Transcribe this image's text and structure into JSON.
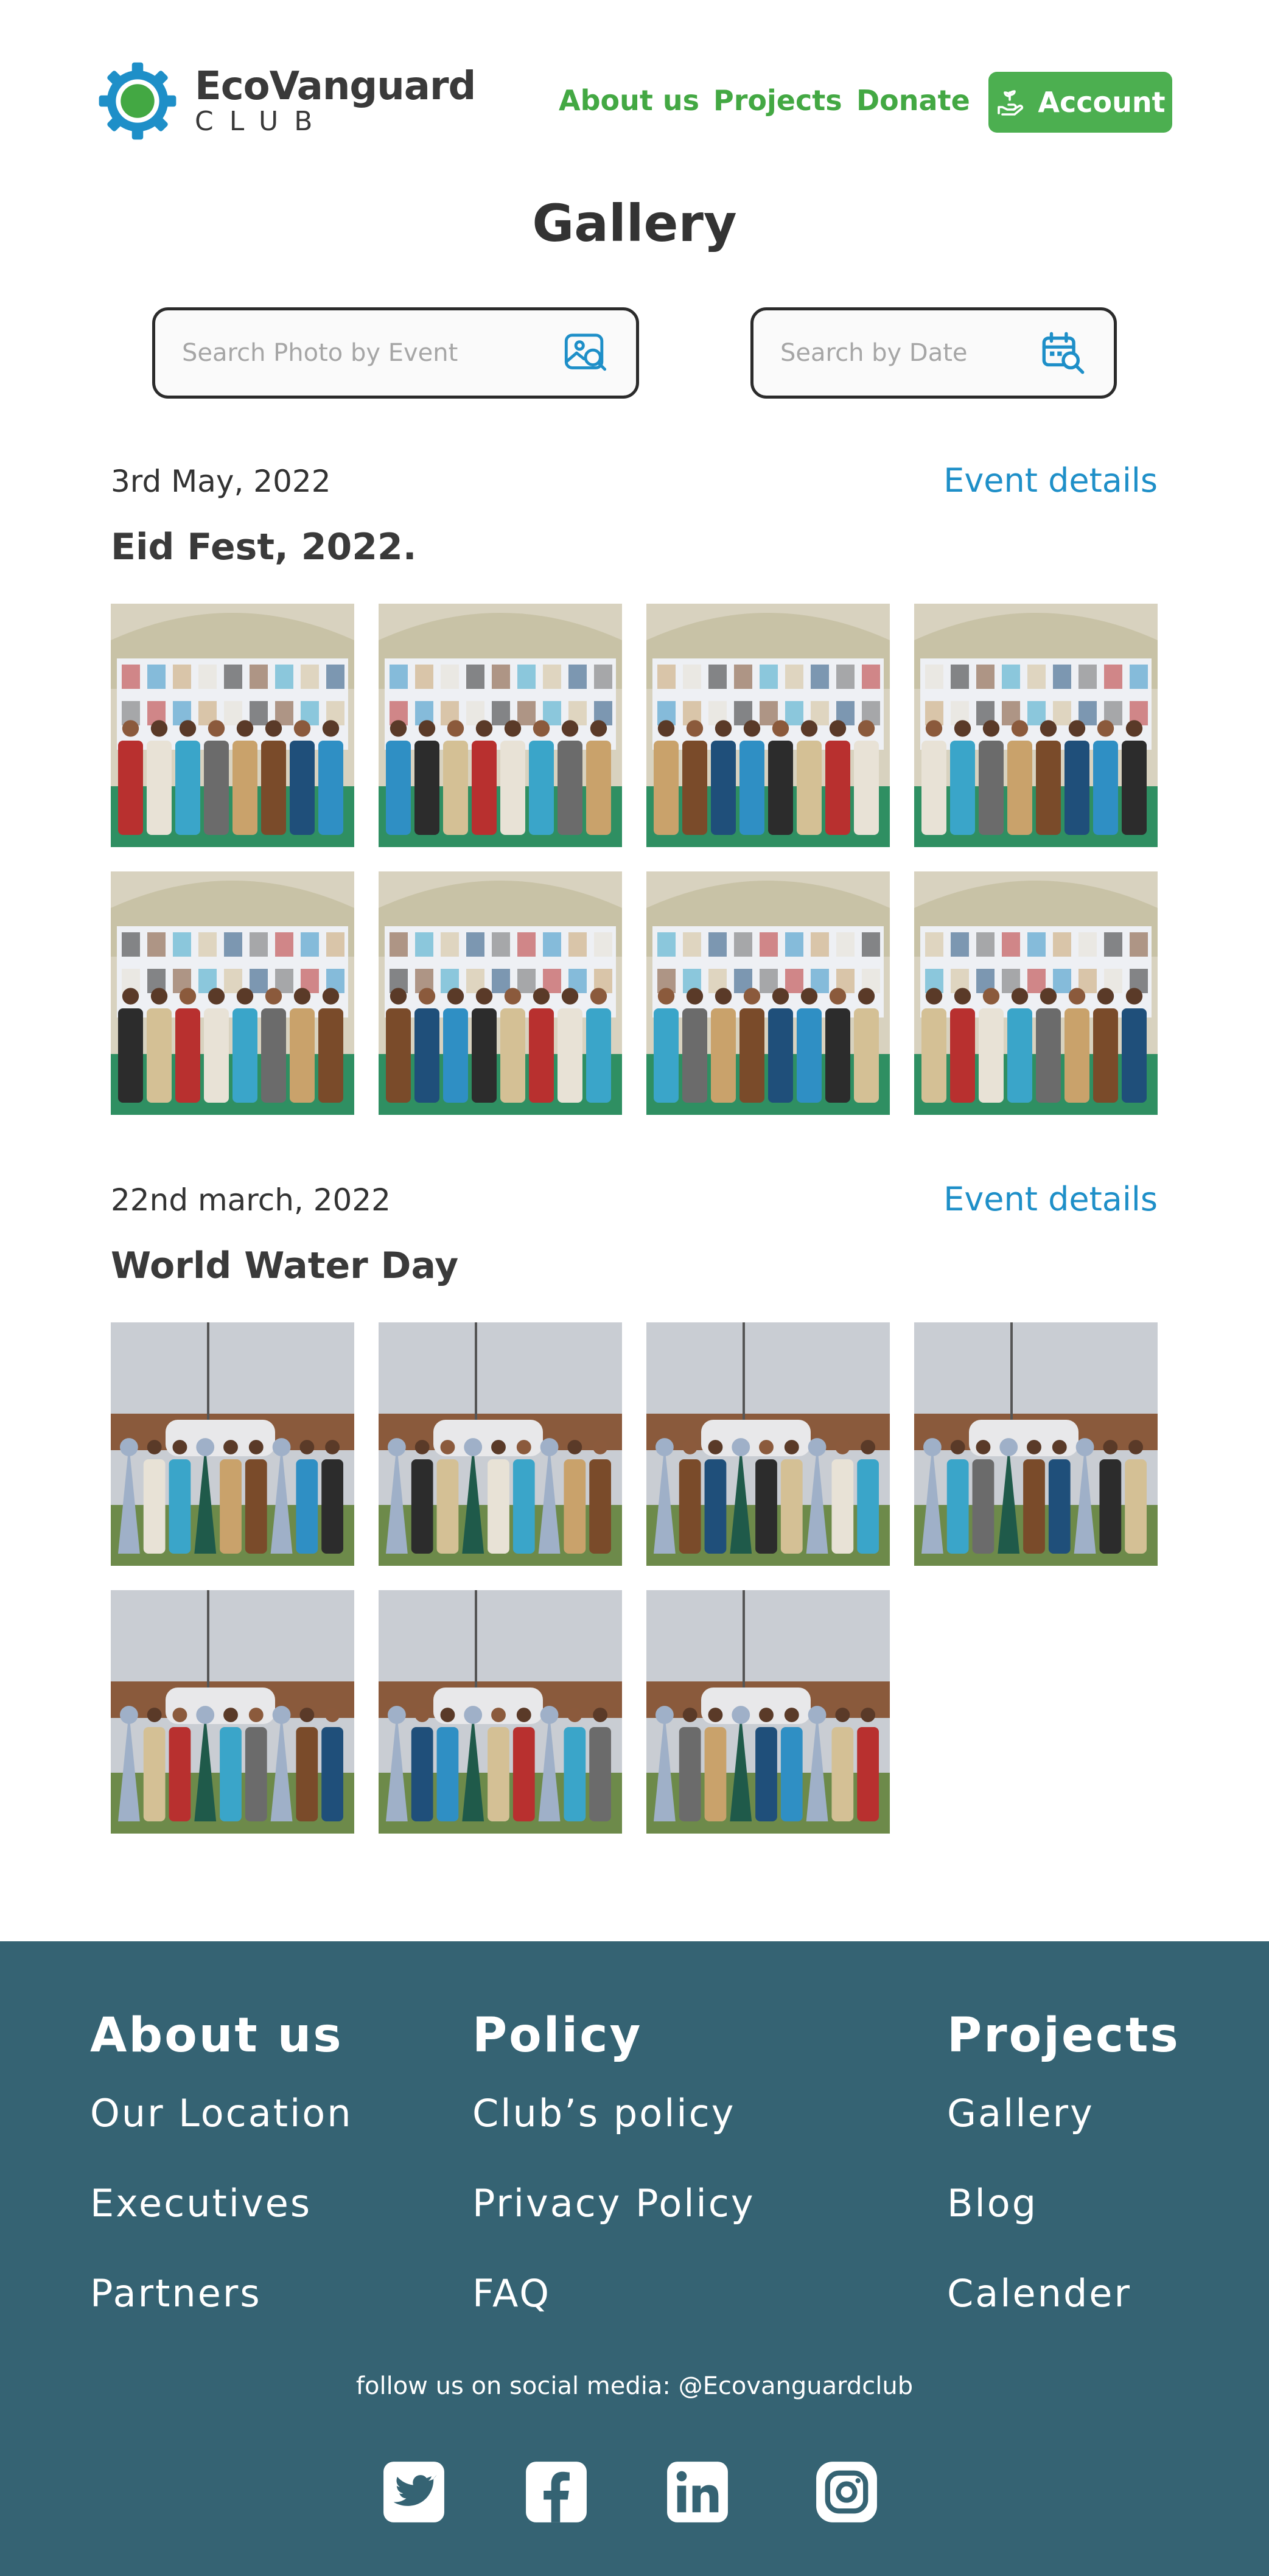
{
  "brand": {
    "name": "EcoVanguard",
    "sub": "CLUB",
    "green": "#43a843",
    "blue": "#1e8fc8"
  },
  "nav": {
    "about": "About us",
    "projects": "Projects",
    "donate": "Donate",
    "account": "Account",
    "account_icon": "hand-plant-icon"
  },
  "page": {
    "title": "Gallery"
  },
  "search": {
    "event_placeholder": "Search Photo by Event",
    "event_icon": "image-search-icon",
    "date_placeholder": "Search by Date",
    "date_icon": "calendar-search-icon"
  },
  "events": [
    {
      "date": "3rd May, 2022",
      "link": "Event details",
      "name": "Eid Fest, 2022.",
      "photos": 8
    },
    {
      "date": "22nd march, 2022",
      "link": "Event details",
      "name": "World Water Day",
      "photos": 7
    }
  ],
  "footer": {
    "bg": "#356373",
    "about": {
      "heading": "About us",
      "items": [
        "Our Location",
        "Executives",
        "Partners"
      ]
    },
    "policy": {
      "heading": "Policy",
      "items": [
        "Club’s policy",
        "Privacy Policy",
        "FAQ"
      ]
    },
    "projects": {
      "heading": "Projects",
      "items": [
        "Gallery",
        "Blog",
        "Calender"
      ]
    },
    "social_text": "follow us on social media: @Ecovanguardclub",
    "social_icons": [
      "twitter-icon",
      "facebook-icon",
      "linkedin-icon",
      "instagram-icon"
    ]
  }
}
